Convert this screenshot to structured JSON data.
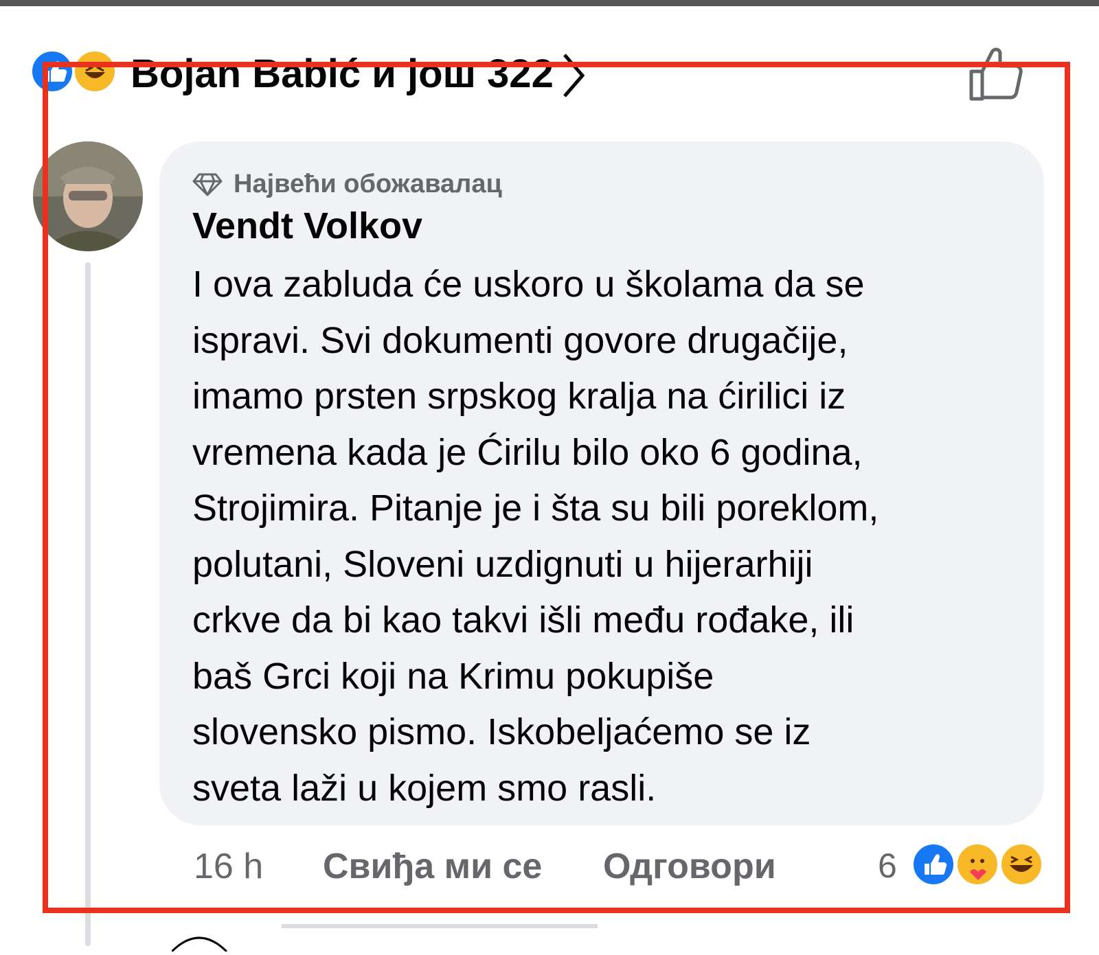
{
  "reactions_summary": {
    "names_text": "Bojan Babić и још 322",
    "icons": [
      "like-icon",
      "haha-icon"
    ]
  },
  "comment": {
    "badge": "Највећи обожавалац",
    "author": "Vendt Volkov",
    "text_lines": [
      "I ova zabluda će uskoro u školama da se",
      "ispravi. Svi dokumenti govore drugačije,",
      "imamo prsten srpskog kralja na ćirilici iz",
      "vremena kada je Ćirilu bilo oko 6 godina,",
      "Strojimira. Pitanje je i šta su bili poreklom,",
      "polutani, Sloveni uzdignuti u hijerarhiji",
      "crkve da bi kao takvi išli među rođake, ili",
      "baš Grci koji na Krimu pokupiše",
      "slovensko pismo. Iskobeljaćemo se iz",
      "sveta laži u kojem smo rasli."
    ],
    "time": "16 h",
    "like_label": "Свиђа ми се",
    "reply_label": "Одговори",
    "reaction_count": "6",
    "reaction_icons": [
      "like-icon",
      "care-icon",
      "haha-icon"
    ]
  },
  "colors": {
    "bubble": "#f0f2f5",
    "secondary_text": "#65676b",
    "highlight": "#e8321e",
    "like_blue": "#1877f2"
  }
}
